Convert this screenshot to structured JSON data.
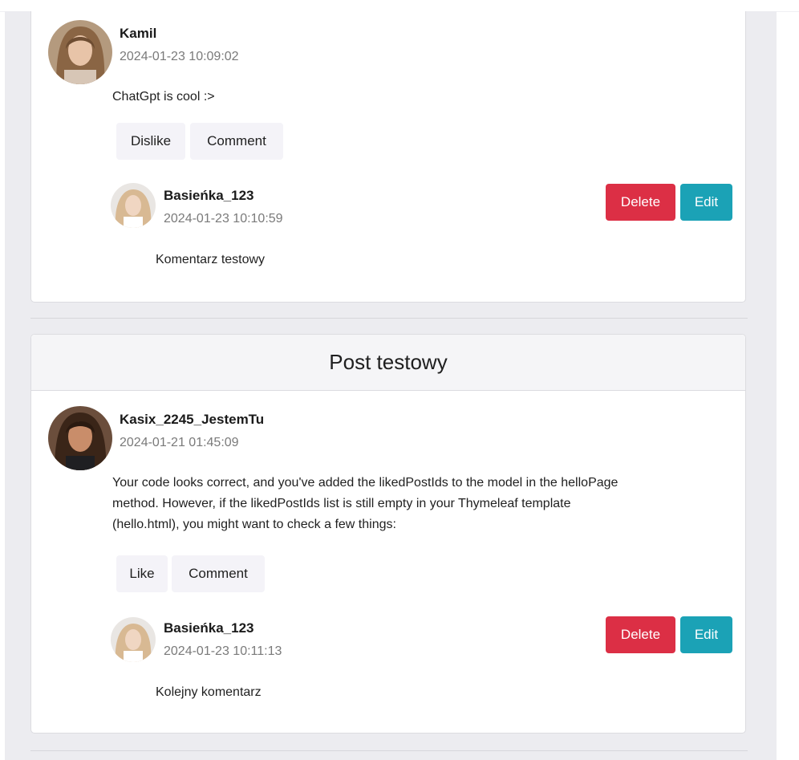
{
  "posts": [
    {
      "title": "",
      "author": "Kamil",
      "date": "2024-01-23 10:09:02",
      "content": "ChatGpt is cool :>",
      "actions": {
        "like": "Dislike",
        "comment": "Comment"
      },
      "comment": {
        "author": "Basieńka_123",
        "date": "2024-01-23 10:10:59",
        "content": "Komentarz testowy",
        "delete": "Delete",
        "edit": "Edit"
      }
    },
    {
      "title": "Post testowy",
      "author": "Kasix_2245_JestemTu",
      "date": "2024-01-21 01:45:09",
      "content_lines": [
        "Your code looks correct, and you've added the likedPostIds to the model in the helloPage",
        "method. However, if the likedPostIds list is still empty in your Thymeleaf template",
        "(hello.html), you might want to check a few things:"
      ],
      "actions": {
        "like": "Like",
        "comment": "Comment"
      },
      "comment": {
        "author": "Basieńka_123",
        "date": "2024-01-23 10:11:13",
        "content": "Kolejny komentarz",
        "delete": "Delete",
        "edit": "Edit"
      }
    }
  ],
  "colors": {
    "delete": "#dc2f45",
    "edit": "#1ba2b6",
    "page_bg": "#ececf0"
  }
}
